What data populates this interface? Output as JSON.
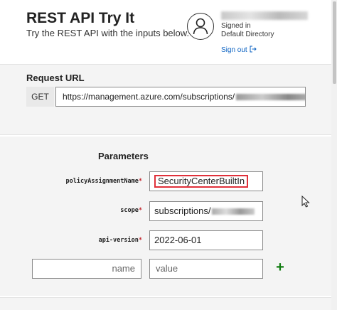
{
  "header": {
    "title": "REST API Try It",
    "subtitle": "Try the REST API with the inputs below.",
    "user": {
      "status": "Signed in",
      "directory": "Default Directory",
      "signout_label": "Sign out"
    }
  },
  "request": {
    "label": "Request URL",
    "method": "GET",
    "url": "https://management.azure.com/subscriptions/"
  },
  "parameters": {
    "label": "Parameters",
    "required_marker": "*",
    "fields": [
      {
        "name": "policyAssignmentName",
        "value": "SecurityCenterBuiltIn"
      },
      {
        "name": "scope",
        "value": "subscriptions/"
      },
      {
        "name": "api-version",
        "value": "2022-06-01"
      }
    ],
    "new_param": {
      "name_placeholder": "name",
      "value_placeholder": "value",
      "add_symbol": "+"
    }
  },
  "colors": {
    "accent_link": "#0b62c2",
    "required": "#c4262e",
    "highlight_box": "#e0303a",
    "add_icon": "#107c10"
  },
  "icons": [
    "user-avatar-icon",
    "sign-out-icon",
    "add-icon",
    "mouse-cursor-icon"
  ]
}
